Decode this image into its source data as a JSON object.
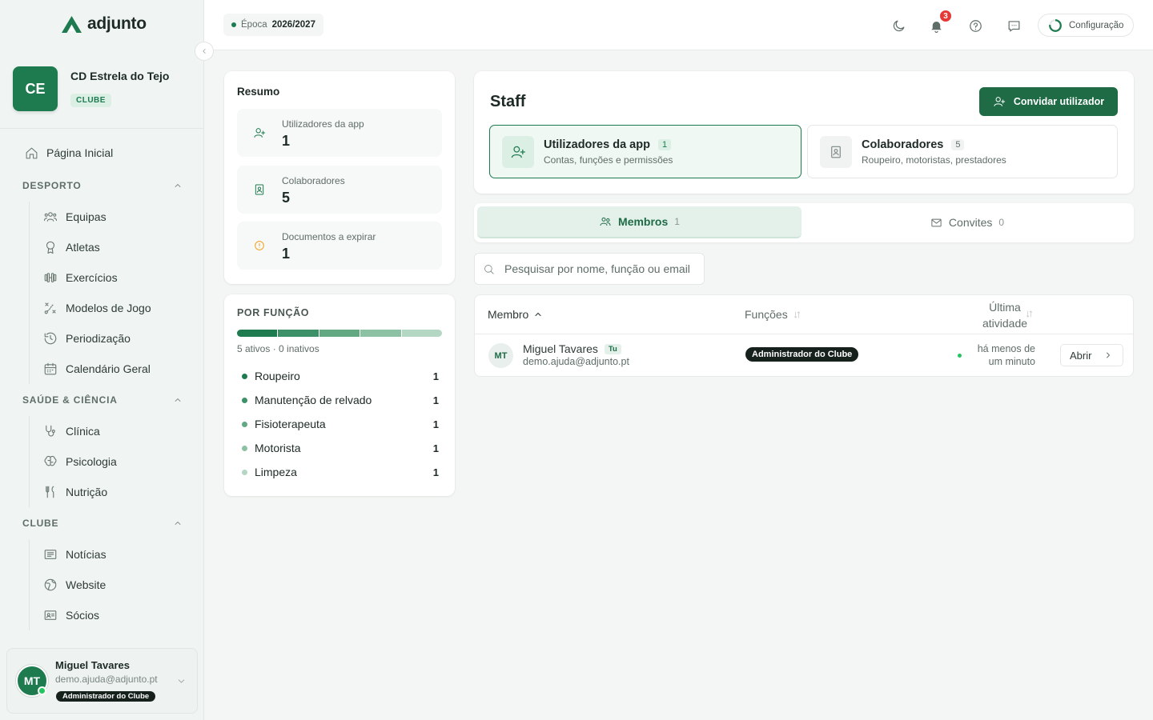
{
  "brand": {
    "name": "adjunto"
  },
  "club": {
    "initials": "CE",
    "name": "CD Estrela do Tejo",
    "badge": "CLUBE"
  },
  "nav": {
    "home": "Página Inicial",
    "sections": [
      {
        "title": "DESPORTO",
        "items": [
          "Equipas",
          "Atletas",
          "Exercícios",
          "Modelos de Jogo",
          "Periodização",
          "Calendário Geral"
        ]
      },
      {
        "title": "SAÚDE & CIÊNCIA",
        "items": [
          "Clínica",
          "Psicologia",
          "Nutrição"
        ]
      },
      {
        "title": "CLUBE",
        "items": [
          "Notícias",
          "Website",
          "Sócios"
        ]
      }
    ]
  },
  "user": {
    "initials": "MT",
    "name": "Miguel Tavares",
    "email": "demo.ajuda@adjunto.pt",
    "role": "Administrador do Clube"
  },
  "topbar": {
    "season_label": "Época",
    "season_value": "2026/2027",
    "notifications": "3",
    "config": "Configuração"
  },
  "resumo": {
    "title": "Resumo",
    "items": [
      {
        "label": "Utilizadores da app",
        "value": "1",
        "icon": "user-plus-icon"
      },
      {
        "label": "Colaboradores",
        "value": "5",
        "icon": "badge-icon"
      },
      {
        "label": "Documentos a expirar",
        "value": "1",
        "icon": "alert-icon"
      }
    ]
  },
  "por_funcao": {
    "title": "POR FUNÇÃO",
    "summary": "5 ativos · 0 inativos",
    "roles": [
      {
        "name": "Roupeiro",
        "count": "1",
        "color": "#1e7a4f"
      },
      {
        "name": "Manutenção de relvado",
        "count": "1",
        "color": "#3d9168"
      },
      {
        "name": "Fisioterapeuta",
        "count": "1",
        "color": "#62a983"
      },
      {
        "name": "Motorista",
        "count": "1",
        "color": "#8cc2a3"
      },
      {
        "name": "Limpeza",
        "count": "1",
        "color": "#b3d7c3"
      }
    ]
  },
  "staff": {
    "title": "Staff",
    "invite_button": "Convidar utilizador",
    "tabs": [
      {
        "name": "Utilizadores da app",
        "count": "1",
        "desc": "Contas, funções e permissões"
      },
      {
        "name": "Colaboradores",
        "count": "5",
        "desc": "Roupeiro, motoristas, prestadores"
      }
    ]
  },
  "segments": [
    {
      "label": "Membros",
      "count": "1"
    },
    {
      "label": "Convites",
      "count": "0"
    }
  ],
  "search": {
    "placeholder": "Pesquisar por nome, função ou email"
  },
  "table": {
    "columns": {
      "member": "Membro",
      "roles": "Funções",
      "activity_line1": "Última",
      "activity_line2": "atividade"
    },
    "rows": [
      {
        "initials": "MT",
        "name": "Miguel Tavares",
        "tag": "Tu",
        "email": "demo.ajuda@adjunto.pt",
        "role": "Administrador do Clube",
        "activity_line1": "há menos de",
        "activity_line2": "um minuto",
        "action": "Abrir"
      }
    ]
  },
  "colors": {
    "primary": "#1e7a4f",
    "primary_dark": "#1e6b46",
    "badge_dark": "#16211c",
    "notification": "#e53935",
    "online": "#22c55e"
  }
}
